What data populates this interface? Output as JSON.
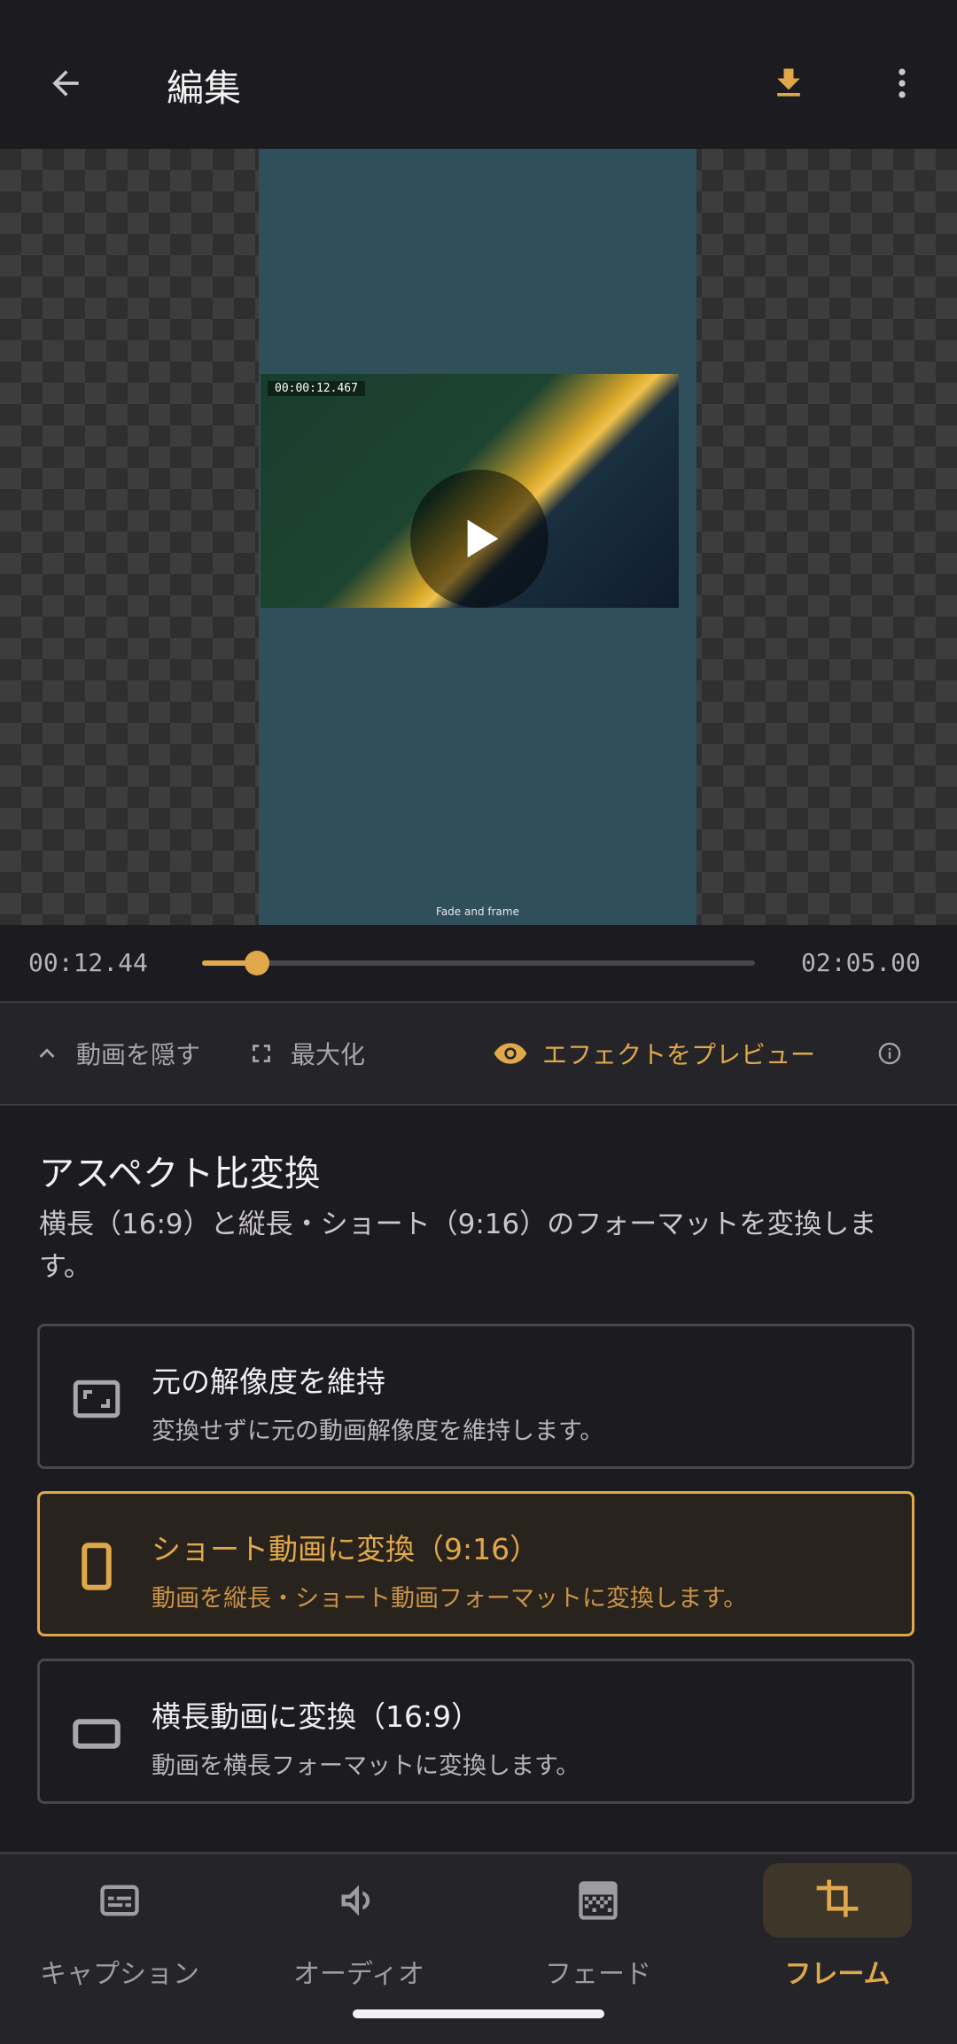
{
  "app_bar": {
    "title": "編集",
    "back_icon": "arrow-back-icon",
    "download_icon": "download-icon",
    "more_icon": "more-vert-icon",
    "accent_color": "#e0a84a"
  },
  "preview": {
    "video_timestamp": "00:00:12.467",
    "caption": "Fade and frame",
    "play_icon": "play-icon"
  },
  "player": {
    "current_time": "00:12.44",
    "total_time": "02:05.00",
    "progress": 0.099
  },
  "controls": {
    "hide_video": "動画を隠す",
    "maximize": "最大化",
    "preview_effect": "エフェクトをプレビュー",
    "info_icon": "info-icon"
  },
  "aspect": {
    "title": "アスペクト比変換",
    "description": "横長（16:9）と縦長・ショート（9:16）のフォーマットを変換します。",
    "options": [
      {
        "title": "元の解像度を維持",
        "description": "変換せずに元の動画解像度を維持します。",
        "icon": "aspect-ratio-icon",
        "selected": false
      },
      {
        "title": "ショート動画に変換（9:16）",
        "description": "動画を縦長・ショート動画フォーマットに変換します。",
        "icon": "portrait-phone-icon",
        "selected": true
      },
      {
        "title": "横長動画に変換（16:9）",
        "description": "動画を横長フォーマットに変換します。",
        "icon": "landscape-icon",
        "selected": false
      }
    ]
  },
  "bottom_nav": {
    "items": [
      {
        "label": "キャプション",
        "icon": "subtitles-icon",
        "active": false
      },
      {
        "label": "オーディオ",
        "icon": "volume-icon",
        "active": false
      },
      {
        "label": "フェード",
        "icon": "gradient-icon",
        "active": false
      },
      {
        "label": "フレーム",
        "icon": "crop-icon",
        "active": true
      }
    ]
  }
}
